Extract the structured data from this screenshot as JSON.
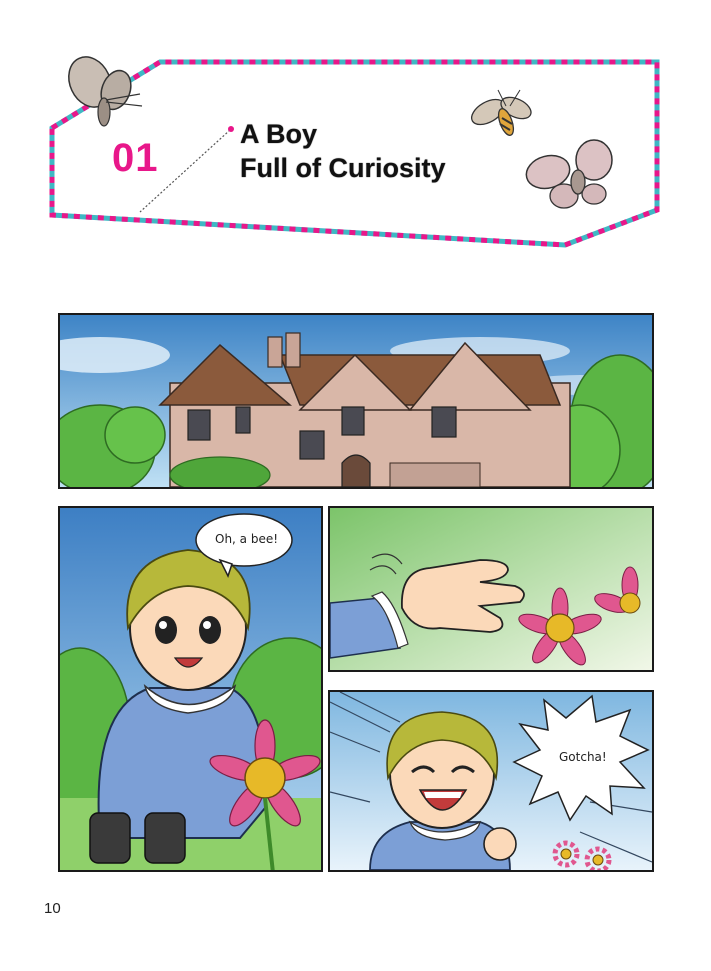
{
  "chapter": {
    "number": "01",
    "title_line1": "A Boy",
    "title_line2": "Full of Curiosity"
  },
  "panels": {
    "boy": {
      "speech": "Oh, a bee!"
    },
    "gotcha": {
      "speech": "Gotcha!"
    }
  },
  "page_number": "10",
  "colors": {
    "accent_pink": "#e8178a",
    "border_teal": "#3fb8c4",
    "sky_blue": "#4a8fd0",
    "house_brick": "#d9b7a8",
    "roof_brown": "#8b5a3c",
    "foliage_green": "#5bb544",
    "flower_pink": "#e0578f",
    "boy_outfit": "#7c9fd6",
    "boy_hair": "#b7b83a"
  },
  "icons": [
    "moth-icon",
    "bee-icon",
    "flower-icon"
  ]
}
